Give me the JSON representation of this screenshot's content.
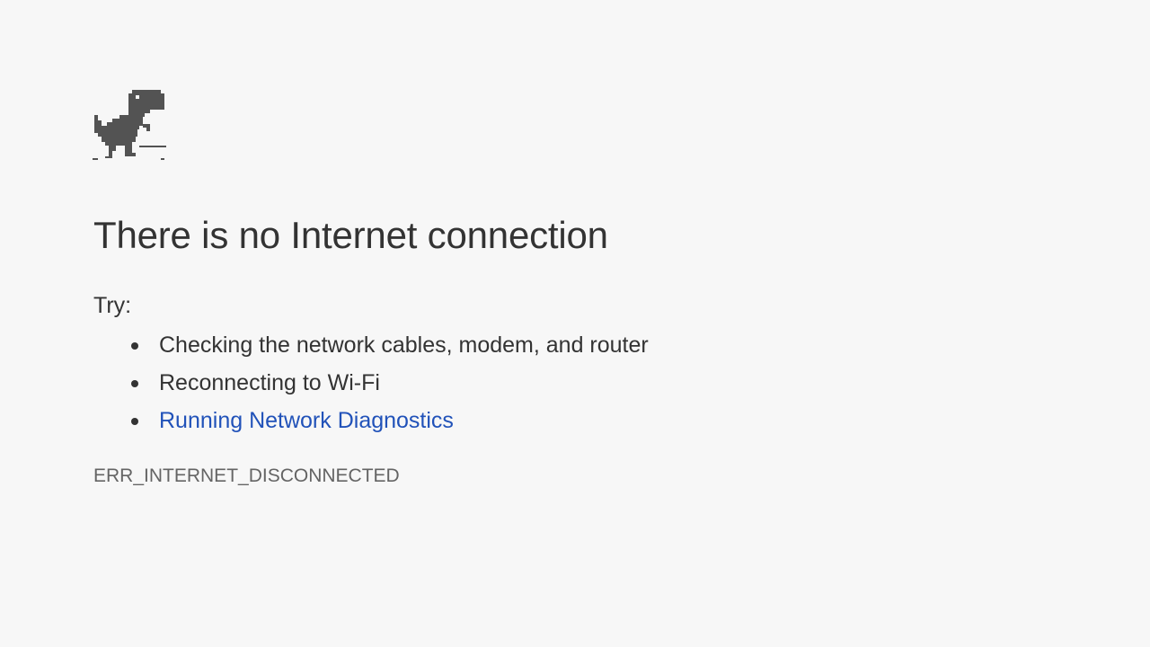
{
  "page": {
    "icon": "offline-dino-icon",
    "title": "There is no Internet connection",
    "try_label": "Try:",
    "suggestions": [
      {
        "text": "Checking the network cables, modem, and router",
        "is_link": false
      },
      {
        "text": "Reconnecting to Wi-Fi",
        "is_link": false
      },
      {
        "text": "Running Network Diagnostics",
        "is_link": true
      }
    ],
    "error_code": "ERR_INTERNET_DISCONNECTED"
  },
  "colors": {
    "background": "#f7f7f7",
    "text": "#333333",
    "link": "#2152b9",
    "error_code": "#646464",
    "dino": "#535353"
  }
}
